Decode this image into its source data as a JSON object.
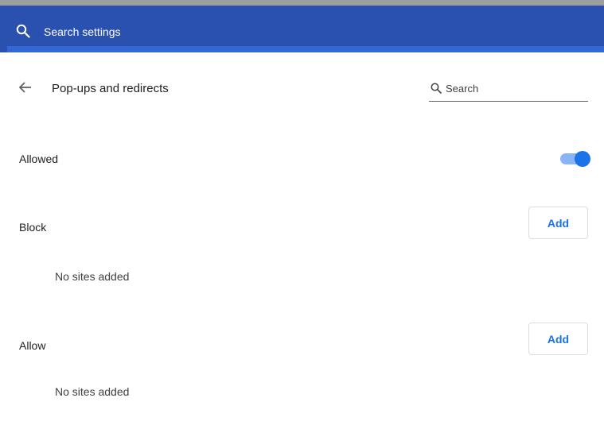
{
  "header": {
    "search_placeholder": "Search settings"
  },
  "subpage": {
    "title": "Pop-ups and redirects",
    "search_placeholder": "Search"
  },
  "default_setting": {
    "label": "Allowed",
    "enabled": true
  },
  "block_section": {
    "label": "Block",
    "add_label": "Add",
    "empty_text": "No sites added"
  },
  "allow_section": {
    "label": "Allow",
    "add_label": "Add",
    "empty_text": "No sites added"
  },
  "colors": {
    "header": "#2b51b0",
    "accent": "#1a73e8",
    "toggle_track": "#8ab4f8"
  },
  "icons": {
    "header_search": "search-icon",
    "back": "arrow-back-icon",
    "subpage_search": "search-icon"
  }
}
